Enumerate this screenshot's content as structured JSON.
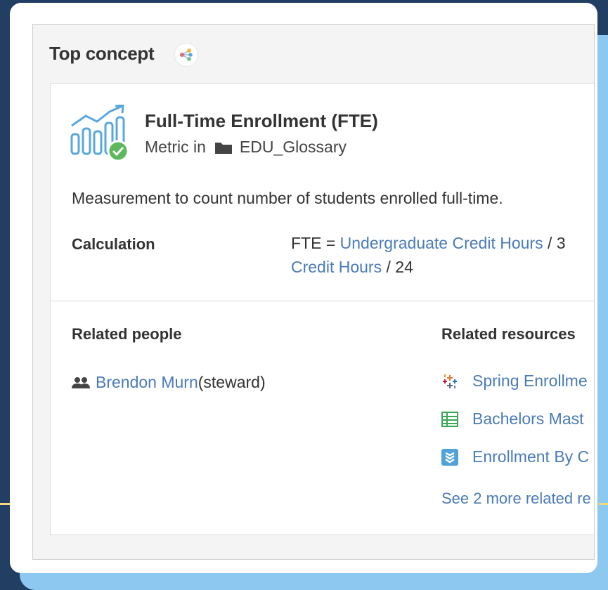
{
  "panel": {
    "title": "Top concept",
    "lineage_icon": "lineage-graph-icon"
  },
  "concept": {
    "icon": "metric-chart-icon",
    "verified_icon": "verified-check-icon",
    "title": "Full-Time Enrollment (FTE)",
    "type_prefix": "Metric in",
    "folder_icon": "folder-icon",
    "folder_name": "EDU_Glossary",
    "description": "Measurement to count number of students enrolled full-time."
  },
  "calculation": {
    "label": "Calculation",
    "prefix": "FTE = ",
    "link1": "Undergraduate Credit Hours",
    "sep1": " / 3",
    "link2": "Credit Hours",
    "suffix": " / 24"
  },
  "related_people": {
    "heading": "Related people",
    "icon": "people-icon",
    "name": "Brendon Murn",
    "role": " (steward)"
  },
  "related_resources": {
    "heading": "Related resources",
    "items": [
      {
        "icon": "tableau-icon",
        "label": "Spring Enrollme"
      },
      {
        "icon": "table-icon",
        "label": "Bachelors Mast"
      },
      {
        "icon": "layers-icon",
        "label": "Enrollment By C"
      }
    ],
    "see_more": "See 2 more related re"
  },
  "colors": {
    "link": "#4a7bb8",
    "background": "#223f63",
    "accent_blue": "#8cc8ef",
    "verified_green": "#5cb85c"
  }
}
